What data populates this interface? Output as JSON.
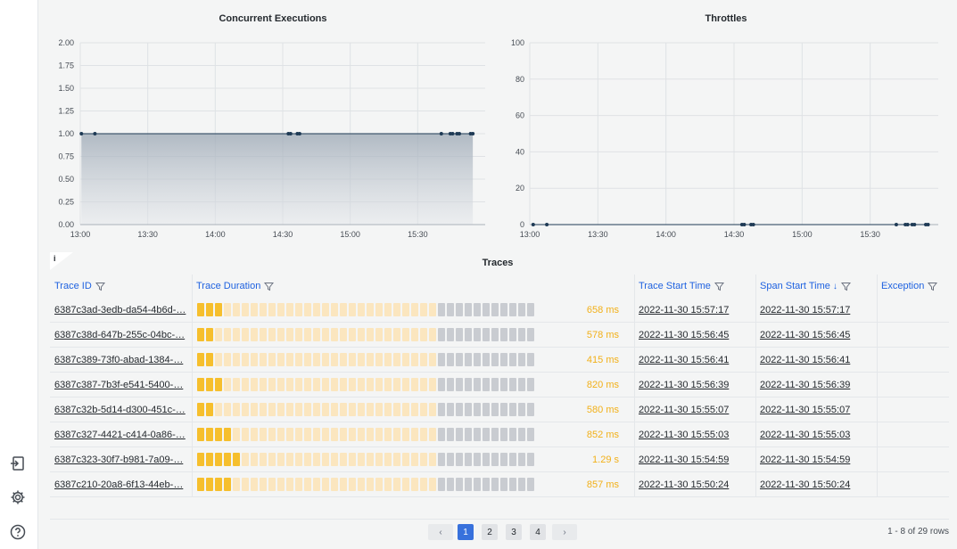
{
  "charts": [
    {
      "chart_data": {
        "type": "line",
        "title": "Concurrent Executions",
        "x_tick_labels": [
          "13:00",
          "13:30",
          "14:00",
          "14:30",
          "15:00",
          "15:30"
        ],
        "y_tick_labels": [
          "2.00",
          "1.75",
          "1.50",
          "1.25",
          "1.00",
          "0.75",
          "0.50",
          "0.25",
          "0.00"
        ],
        "ylim": [
          0,
          2
        ],
        "x_range_minutes": [
          0,
          180
        ],
        "grid": true,
        "area_fill": true,
        "points_minutes": [
          0.5,
          6.5,
          92.5,
          93.5,
          96.5,
          97.5,
          160.5,
          164.5,
          165.5,
          167.5,
          168.5,
          173.5,
          174.5
        ],
        "values": [
          1,
          1,
          1,
          1,
          1,
          1,
          1,
          1,
          1,
          1,
          1,
          1,
          1
        ]
      }
    },
    {
      "chart_data": {
        "type": "line",
        "title": "Throttles",
        "x_tick_labels": [
          "13:00",
          "13:30",
          "14:00",
          "14:30",
          "15:00",
          "15:30"
        ],
        "y_tick_labels": [
          "100",
          "80",
          "60",
          "40",
          "20",
          "0"
        ],
        "ylim": [
          0,
          100
        ],
        "x_range_minutes": [
          0,
          180
        ],
        "grid": true,
        "area_fill": false,
        "points_minutes": [
          1.5,
          7.5,
          93.5,
          94.5,
          97.5,
          98.5,
          161.5,
          165.5,
          166.5,
          168.5,
          169.5,
          174.5,
          175.5
        ],
        "values": [
          0,
          0,
          0,
          0,
          0,
          0,
          0,
          0,
          0,
          0,
          0,
          0,
          0
        ]
      }
    }
  ],
  "traces": {
    "title": "Traces",
    "info_label": "i",
    "columns": [
      "Trace ID",
      "Trace Duration",
      "Trace Start Time",
      "Span Start Time",
      "Exception"
    ],
    "sort_indicator": "↓",
    "rows": [
      {
        "id": "6387c3ad-3edb-da54-4b6d-…",
        "duration": "658 ms",
        "ms": 658,
        "trace_start": "2022-11-30 15:57:17",
        "span_start": "2022-11-30 15:57:17"
      },
      {
        "id": "6387c38d-647b-255c-04bc-…",
        "duration": "578 ms",
        "ms": 578,
        "trace_start": "2022-11-30 15:56:45",
        "span_start": "2022-11-30 15:56:45"
      },
      {
        "id": "6387c389-73f0-abad-1384-…",
        "duration": "415 ms",
        "ms": 415,
        "trace_start": "2022-11-30 15:56:41",
        "span_start": "2022-11-30 15:56:41"
      },
      {
        "id": "6387c387-7b3f-e541-5400-…",
        "duration": "820 ms",
        "ms": 820,
        "trace_start": "2022-11-30 15:56:39",
        "span_start": "2022-11-30 15:56:39"
      },
      {
        "id": "6387c32b-5d14-d300-451c-…",
        "duration": "580 ms",
        "ms": 580,
        "trace_start": "2022-11-30 15:55:07",
        "span_start": "2022-11-30 15:55:07"
      },
      {
        "id": "6387c327-4421-c414-0a86-…",
        "duration": "852 ms",
        "ms": 852,
        "trace_start": "2022-11-30 15:55:03",
        "span_start": "2022-11-30 15:55:03"
      },
      {
        "id": "6387c323-30f7-b981-7a09-…",
        "duration": "1.29 s",
        "ms": 1290,
        "trace_start": "2022-11-30 15:54:59",
        "span_start": "2022-11-30 15:54:59"
      },
      {
        "id": "6387c210-20a8-6f13-44eb-…",
        "duration": "857 ms",
        "ms": 857,
        "trace_start": "2022-11-30 15:50:24",
        "span_start": "2022-11-30 15:50:24"
      }
    ]
  },
  "pagination": {
    "prev": "‹",
    "next": "›",
    "pages": [
      "1",
      "2",
      "3",
      "4"
    ],
    "active_page": "1",
    "rows_info": "1 - 8 of 29 rows"
  },
  "sidebar": {
    "icons": [
      "sign-in-icon",
      "gear-icon",
      "help-icon"
    ]
  },
  "colors": {
    "accent": "#3871dc",
    "link": "#1f62e0",
    "duration": "#f2b018",
    "bar_fill": "#f6bf2d",
    "bar_light": "#fbe6bf",
    "bar_rest": "#c9ccd1",
    "series": "#1e3a55"
  }
}
